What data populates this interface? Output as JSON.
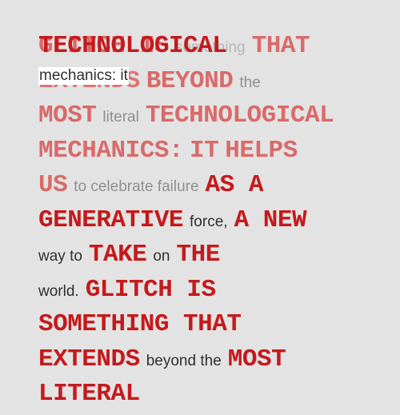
{
  "lines": [
    {
      "base": [
        {
          "text": "GLITCH IS",
          "style": "big ghost"
        },
        {
          "text": "something",
          "style": "small pale"
        },
        {
          "text": "THAT",
          "style": "big ghost"
        }
      ],
      "overlay": [
        {
          "text": "TECHNOLOGICAL",
          "style": "big"
        }
      ]
    },
    {
      "base": [
        {
          "text": "EXTENDS",
          "style": "big ghost2"
        },
        {
          "text": "BEYOND",
          "style": "big ghost"
        },
        {
          "text": "the",
          "style": "small grey"
        }
      ],
      "overlay": [
        {
          "text": "mechanics: it",
          "style": "small bgbox"
        }
      ]
    },
    {
      "base": [
        {
          "text": "MOST",
          "style": "big ghost"
        },
        {
          "text": "literal",
          "style": "small grey"
        },
        {
          "text": "TECHNOLOGICAL",
          "style": "big ghost"
        }
      ]
    },
    {
      "base": [
        {
          "text": "MECHANICS:",
          "style": "big ghost"
        },
        {
          "text": "IT",
          "style": "big ghost"
        },
        {
          "text": "HELPS",
          "style": "big ghost"
        }
      ]
    },
    {
      "base": [
        {
          "text": "US",
          "style": "big ghost"
        },
        {
          "text": "to celebrate failure",
          "style": "small grey"
        },
        {
          "text": "AS A",
          "style": "big"
        }
      ]
    },
    {
      "base": [
        {
          "text": "GENERATIVE",
          "style": "big"
        },
        {
          "text": "force,",
          "style": "small"
        },
        {
          "text": "A NEW",
          "style": "big"
        }
      ]
    },
    {
      "base": [
        {
          "text": "way to",
          "style": "small"
        },
        {
          "text": "TAKE",
          "style": "big"
        },
        {
          "text": "on",
          "style": "small"
        },
        {
          "text": "THE",
          "style": "big"
        }
      ]
    },
    {
      "base": [
        {
          "text": "world.",
          "style": "small"
        },
        {
          "text": "GLITCH IS",
          "style": "big"
        }
      ]
    },
    {
      "base": [
        {
          "text": "SOMETHING THAT",
          "style": "big"
        }
      ]
    },
    {
      "base": [
        {
          "text": "EXTENDS",
          "style": "big"
        },
        {
          "text": "beyond the",
          "style": "small"
        },
        {
          "text": "MOST",
          "style": "big"
        }
      ]
    },
    {
      "base": [
        {
          "text": "LITERAL",
          "style": "big"
        }
      ]
    }
  ]
}
